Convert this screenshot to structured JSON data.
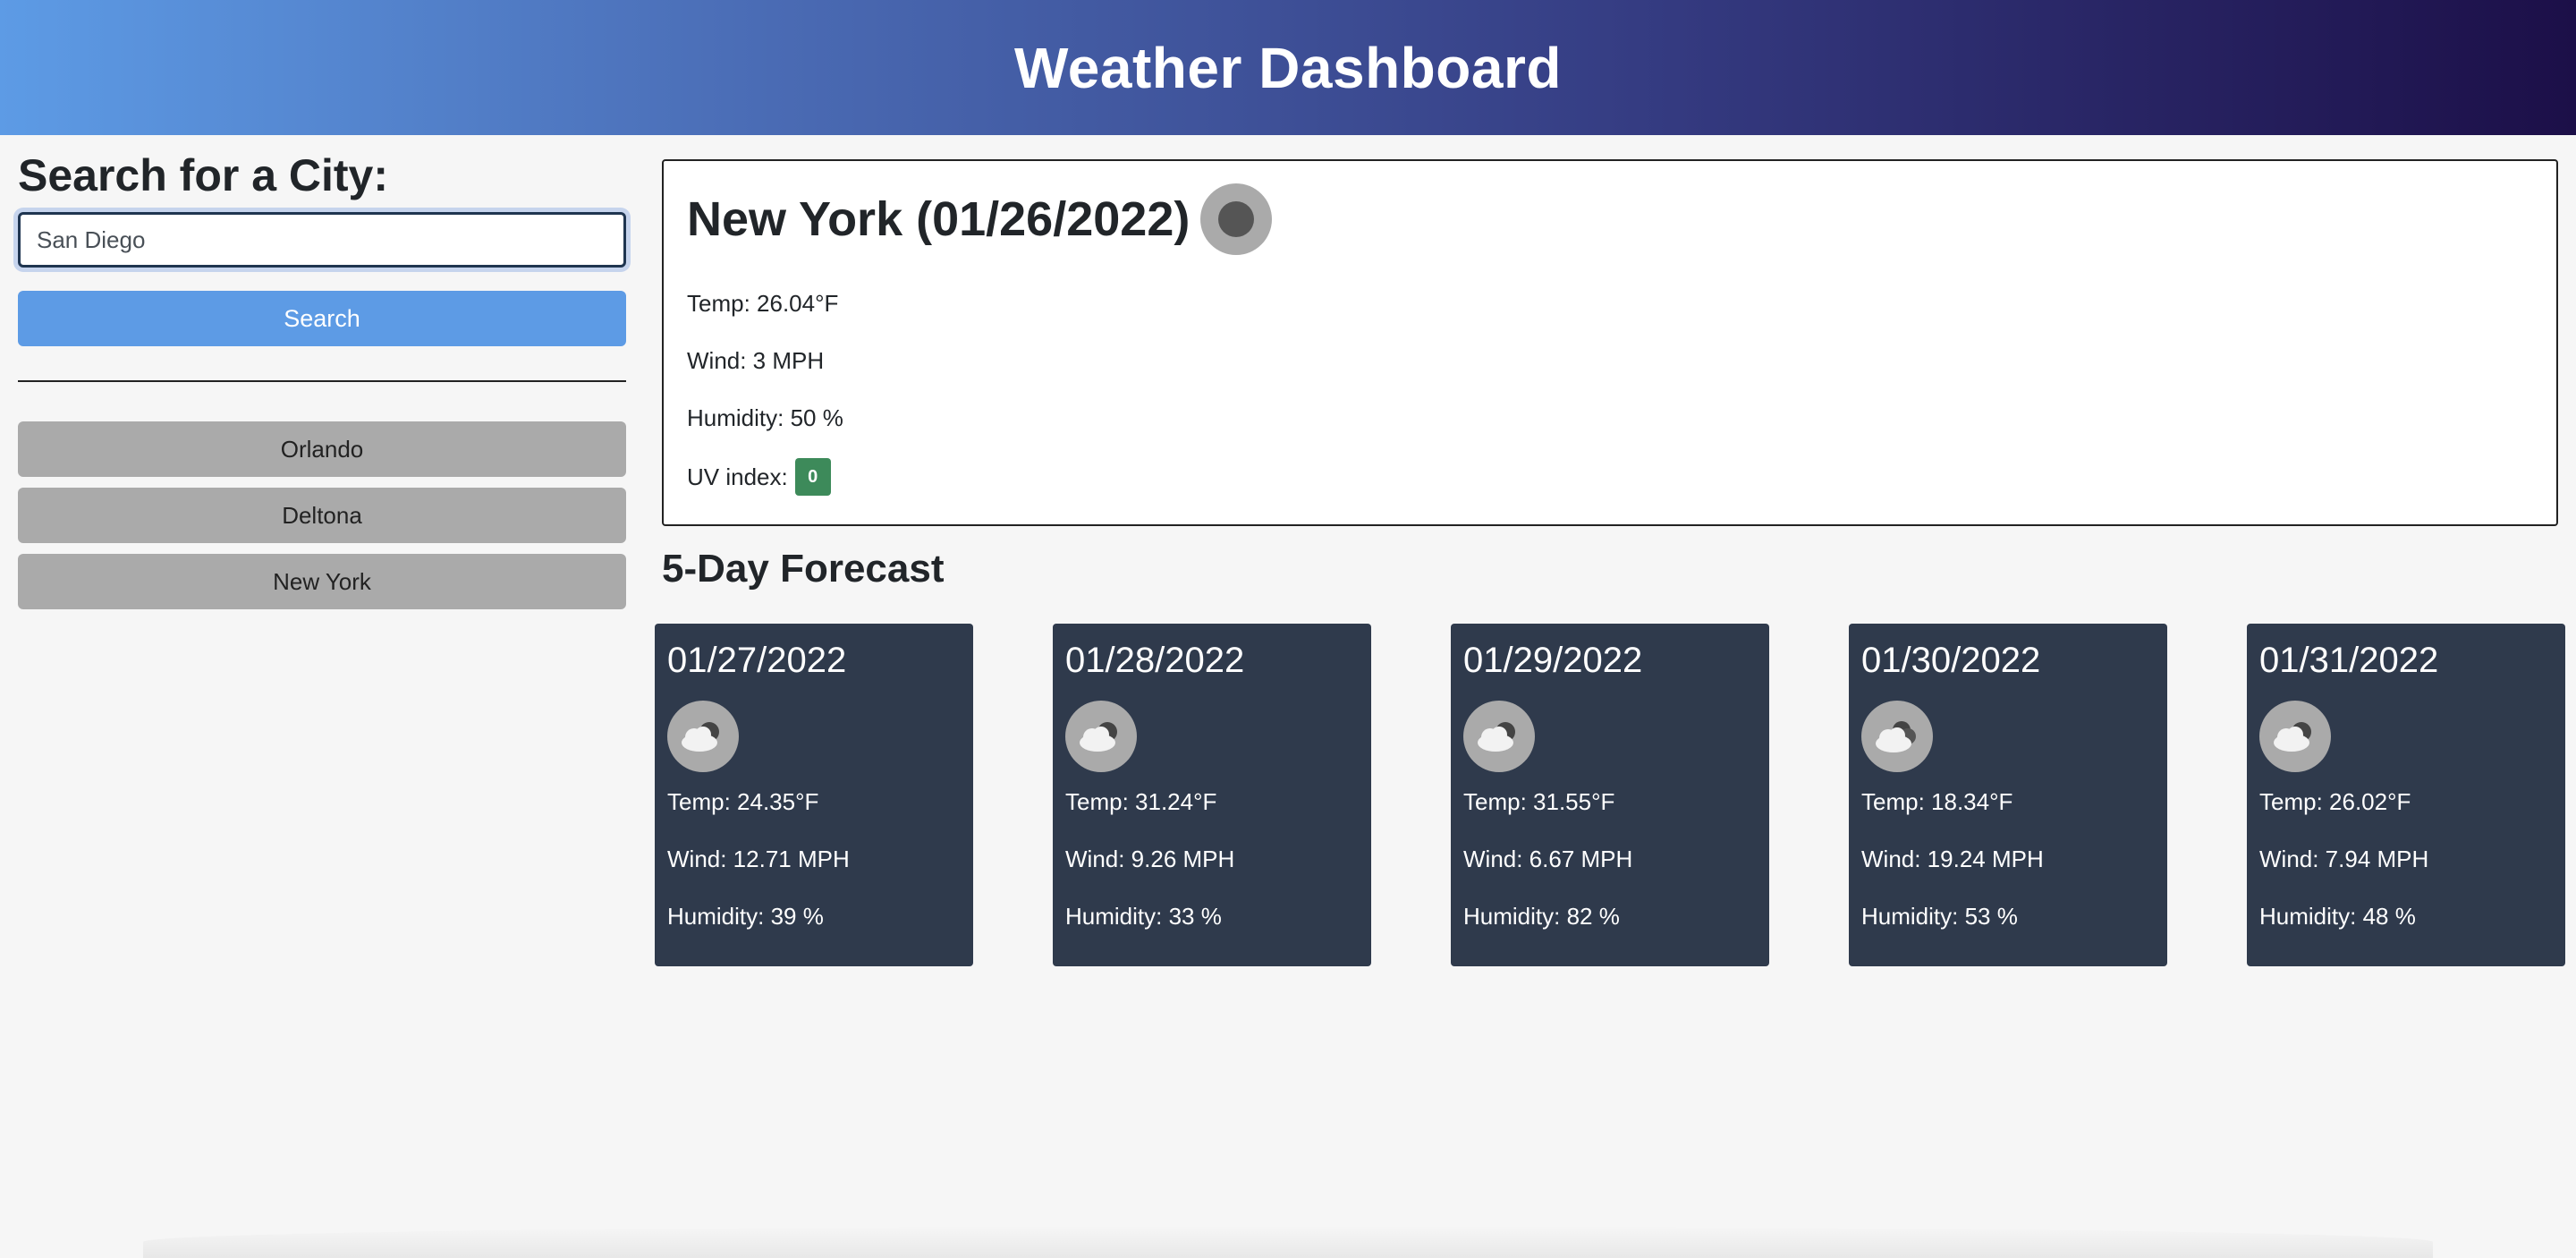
{
  "header": {
    "title": "Weather Dashboard"
  },
  "sidebar": {
    "heading": "Search for a City:",
    "search_value": "San Diego",
    "search_button": "Search",
    "history": [
      "Orlando",
      "Deltona",
      "New York"
    ]
  },
  "current": {
    "title": "New York (01/26/2022)",
    "icon": "dark-circle-icon",
    "temp": "Temp: 26.04°F",
    "wind": "Wind: 3 MPH",
    "humidity": "Humidity: 50 %",
    "uv_label": "UV index:",
    "uv_value": "0",
    "uv_color": "#3d8a5a"
  },
  "forecast": {
    "title": "5-Day Forecast",
    "days": [
      {
        "date": "01/27/2022",
        "icon": "partly-cloudy-icon",
        "temp": "Temp: 24.35°F",
        "wind": "Wind: 12.71 MPH",
        "humidity": "Humidity: 39 %"
      },
      {
        "date": "01/28/2022",
        "icon": "partly-cloudy-icon",
        "temp": "Temp: 31.24°F",
        "wind": "Wind: 9.26 MPH",
        "humidity": "Humidity: 33 %"
      },
      {
        "date": "01/29/2022",
        "icon": "partly-cloudy-icon",
        "temp": "Temp: 31.55°F",
        "wind": "Wind: 6.67 MPH",
        "humidity": "Humidity: 82 %"
      },
      {
        "date": "01/30/2022",
        "icon": "cloudy-icon",
        "temp": "Temp: 18.34°F",
        "wind": "Wind: 19.24 MPH",
        "humidity": "Humidity: 53 %"
      },
      {
        "date": "01/31/2022",
        "icon": "partly-cloudy-icon",
        "temp": "Temp: 26.02°F",
        "wind": "Wind: 7.94 MPH",
        "humidity": "Humidity: 48 %"
      }
    ]
  },
  "colors": {
    "accent": "#5d9be5",
    "card_bg": "#2f3a4c",
    "history_bg": "#aaaaaa"
  }
}
